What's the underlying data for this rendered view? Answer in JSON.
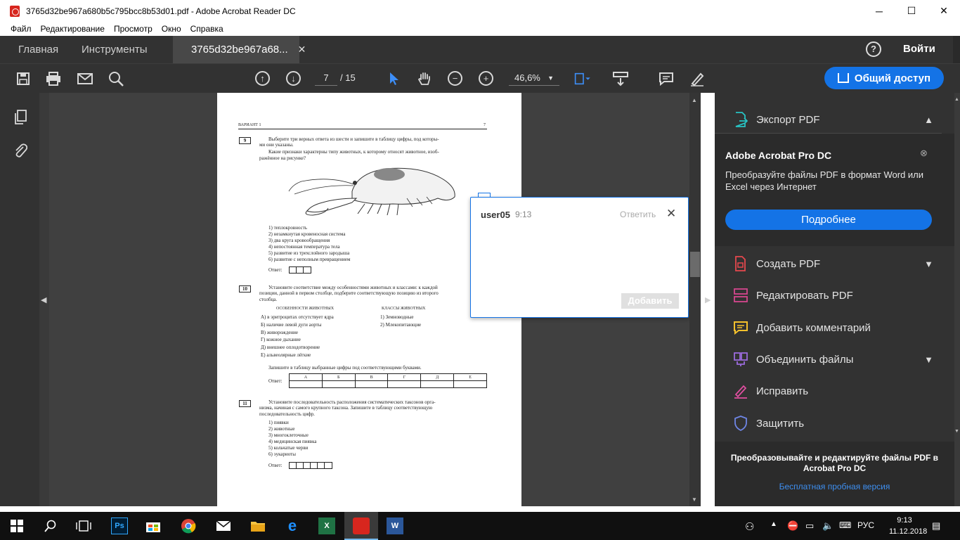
{
  "window": {
    "title": "3765d32be967a680b5c795bcc8b53d01.pdf - Adobe Acrobat Reader DC",
    "minimize": "─",
    "maximize": "☐",
    "close": "✕"
  },
  "menu": [
    "Файл",
    "Редактирование",
    "Просмотр",
    "Окно",
    "Справка"
  ],
  "tabs": {
    "home": "Главная",
    "tools": "Инструменты",
    "doc": "3765d32be967a68...",
    "doc_close": "✕",
    "help": "?",
    "login": "Войти"
  },
  "toolbar": {
    "page_current": "7",
    "page_total": "/ 15",
    "zoom": "46,6%",
    "share": "Общий доступ"
  },
  "page": {
    "header_left": "ВАРИАНТ 1",
    "header_right": "7",
    "q9": {
      "num": "9",
      "l1": "Выберите три верных ответа из шести и запишите в таблицу цифры, под которы-",
      "l2": "ми они указаны.",
      "l3": "Какие признаки характерны типу животных, к которому относят животное, изоб-",
      "l4": "ражённое на рисунке?",
      "o1": "1) теплокровность",
      "o2": "2) незамкнутая кровеносная система",
      "o3": "3) два круга кровообращения",
      "o4": "4) непостоянная температура тела",
      "o5": "5) развитие из трехслойного зародыша",
      "o6": "6) развитие с неполным превращением",
      "answer": "Ответ:"
    },
    "q10": {
      "num": "10",
      "l1": "Установите соответствие между особенностями животных и классами: к каждой",
      "l2": "позиции, данной в первом столбце, подберите соответствующую позицию из второго",
      "l3": "столбца.",
      "col1": "ОСОБЕННОСТИ ЖИВОТНЫХ",
      "col2": "КЛАССЫ ЖИВОТНЫХ",
      "a": "А) в эритроцитах отсутствует ядра",
      "b": "Б) наличие левой дуги аорты",
      "v": "В) живорождение",
      "g": "Г) кожное дыхание",
      "d": "Д) внешнее оплодотворение",
      "e": "Е) альвеолярные лёгкие",
      "c1": "1) Земноводные",
      "c2": "2) Млекопитающие",
      "instr": "Запишите в таблицу выбранные цифры под соответствующими буквами.",
      "answer": "Ответ:",
      "letters": [
        "А",
        "Б",
        "В",
        "Г",
        "Д",
        "Е"
      ]
    },
    "q11": {
      "num": "11",
      "l1": "Установите последовательность расположения систематических таксонов орга-",
      "l2": "низма, начиная с самого крупного таксона. Запишите в таблицу соответствующую",
      "l3": "последовательность цифр.",
      "o1": "1) пиявки",
      "o2": "2) животные",
      "o3": "3) многоклеточные",
      "o4": "4) медицинская пиявка",
      "o5": "5) кольчатые черви",
      "o6": "6) эукариоты",
      "answer": "Ответ:"
    }
  },
  "comment": {
    "user": "user05",
    "time": "9:13",
    "reply": "Ответить",
    "close": "✕",
    "add": "Добавить"
  },
  "right_panel": {
    "export": "Экспорт PDF",
    "promo_title": "Adobe Acrobat Pro DC",
    "promo_text": "Преобразуйте файлы PDF в формат Word или Excel через Интернет",
    "more": "Подробнее",
    "items": [
      "Создать PDF",
      "Редактировать PDF",
      "Добавить комментарий",
      "Объединить файлы",
      "Исправить",
      "Защитить"
    ],
    "bottom_title": "Преобразовывайте и редактируйте файлы PDF в Acrobat Pro DC",
    "bottom_link": "Бесплатная пробная версия"
  },
  "taskbar": {
    "lang": "РУС",
    "time": "9:13",
    "date": "11.12.2018"
  }
}
